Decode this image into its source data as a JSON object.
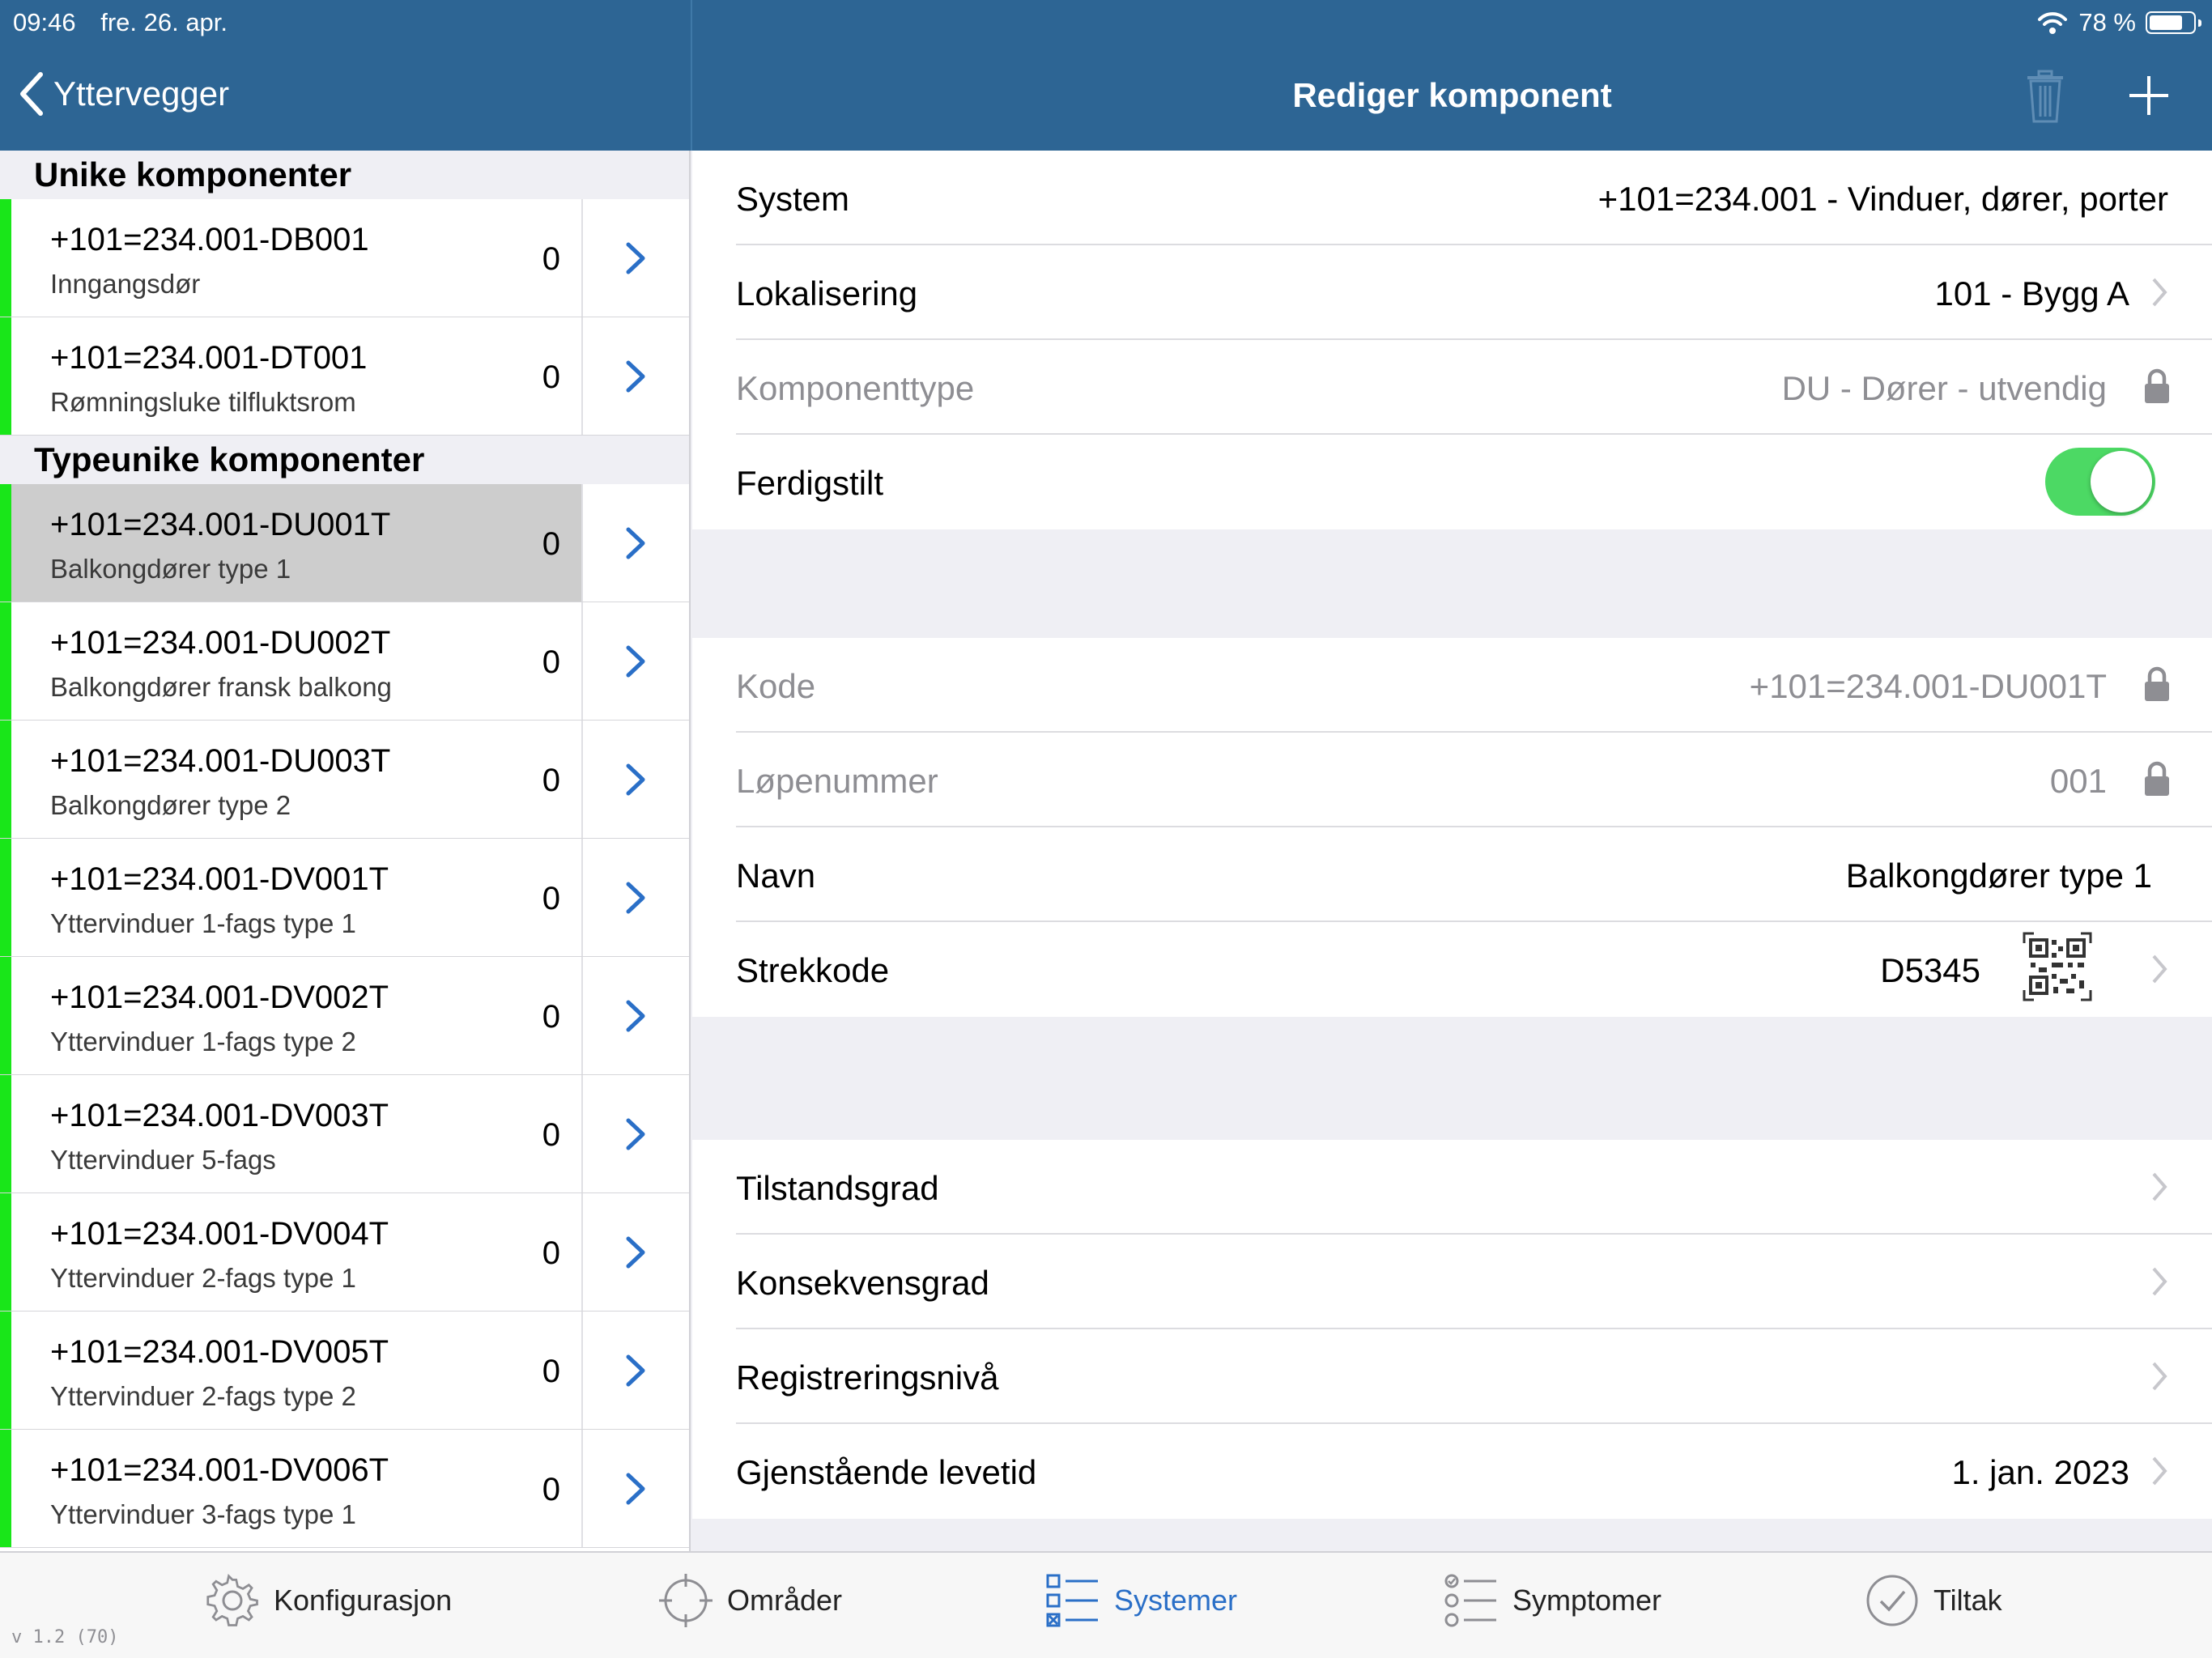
{
  "status": {
    "time": "09:46",
    "date": "fre. 26. apr.",
    "battery": "78 %"
  },
  "nav": {
    "back_label": "Yttervegger",
    "title": "Rediger komponent"
  },
  "left": {
    "sections": [
      {
        "title": "Unike komponenter",
        "rows": [
          {
            "code": "+101=234.001-DB001",
            "desc": "Inngangsdør",
            "count": "0"
          },
          {
            "code": "+101=234.001-DT001",
            "desc": "Rømningsluke tilfluktsrom",
            "count": "0"
          }
        ]
      },
      {
        "title": "Typeunike komponenter",
        "rows": [
          {
            "code": "+101=234.001-DU001T",
            "desc": "Balkongdører type 1",
            "count": "0",
            "selected": true
          },
          {
            "code": "+101=234.001-DU002T",
            "desc": "Balkongdører fransk balkong",
            "count": "0"
          },
          {
            "code": "+101=234.001-DU003T",
            "desc": "Balkongdører type 2",
            "count": "0"
          },
          {
            "code": "+101=234.001-DV001T",
            "desc": "Yttervinduer 1-fags type 1",
            "count": "0"
          },
          {
            "code": "+101=234.001-DV002T",
            "desc": "Yttervinduer 1-fags type 2",
            "count": "0"
          },
          {
            "code": "+101=234.001-DV003T",
            "desc": "Yttervinduer 5-fags",
            "count": "0"
          },
          {
            "code": "+101=234.001-DV004T",
            "desc": "Yttervinduer 2-fags type 1",
            "count": "0"
          },
          {
            "code": "+101=234.001-DV005T",
            "desc": "Yttervinduer 2-fags type 2",
            "count": "0"
          },
          {
            "code": "+101=234.001-DV006T",
            "desc": "Yttervinduer 3-fags type 1",
            "count": "0"
          }
        ]
      }
    ]
  },
  "form": {
    "system": {
      "label": "System",
      "value": "+101=234.001 - Vinduer, dører, porter"
    },
    "lokalisering": {
      "label": "Lokalisering",
      "value": "101 - Bygg A"
    },
    "komponenttype": {
      "label": "Komponenttype",
      "value": "DU - Dører - utvendig"
    },
    "ferdigstilt": {
      "label": "Ferdigstilt",
      "on": true
    },
    "kode": {
      "label": "Kode",
      "value": "+101=234.001-DU001T"
    },
    "lopenummer": {
      "label": "Løpenummer",
      "value": "001"
    },
    "navn": {
      "label": "Navn",
      "value": "Balkongdører type 1"
    },
    "strekkode": {
      "label": "Strekkode",
      "value": "D5345"
    },
    "tilstandsgrad": {
      "label": "Tilstandsgrad"
    },
    "konsekvensgrad": {
      "label": "Konsekvensgrad"
    },
    "registreringsniva": {
      "label": "Registreringsnivå"
    },
    "levetid": {
      "label": "Gjenstående levetid",
      "value": "1. jan. 2023"
    }
  },
  "tabs": [
    {
      "label": "Konfigurasjon",
      "icon": "gear-icon"
    },
    {
      "label": "Områder",
      "icon": "crosshair-icon"
    },
    {
      "label": "Systemer",
      "icon": "list-checkbox-icon",
      "active": true
    },
    {
      "label": "Symptomer",
      "icon": "list-circle-icon"
    },
    {
      "label": "Tiltak",
      "icon": "check-circle-icon"
    }
  ],
  "version": "v 1.2 (70)",
  "colors": {
    "header": "#2d6594",
    "accent": "#2a6fc7",
    "status_green": "#19e619",
    "toggle_on": "#4cd964"
  }
}
